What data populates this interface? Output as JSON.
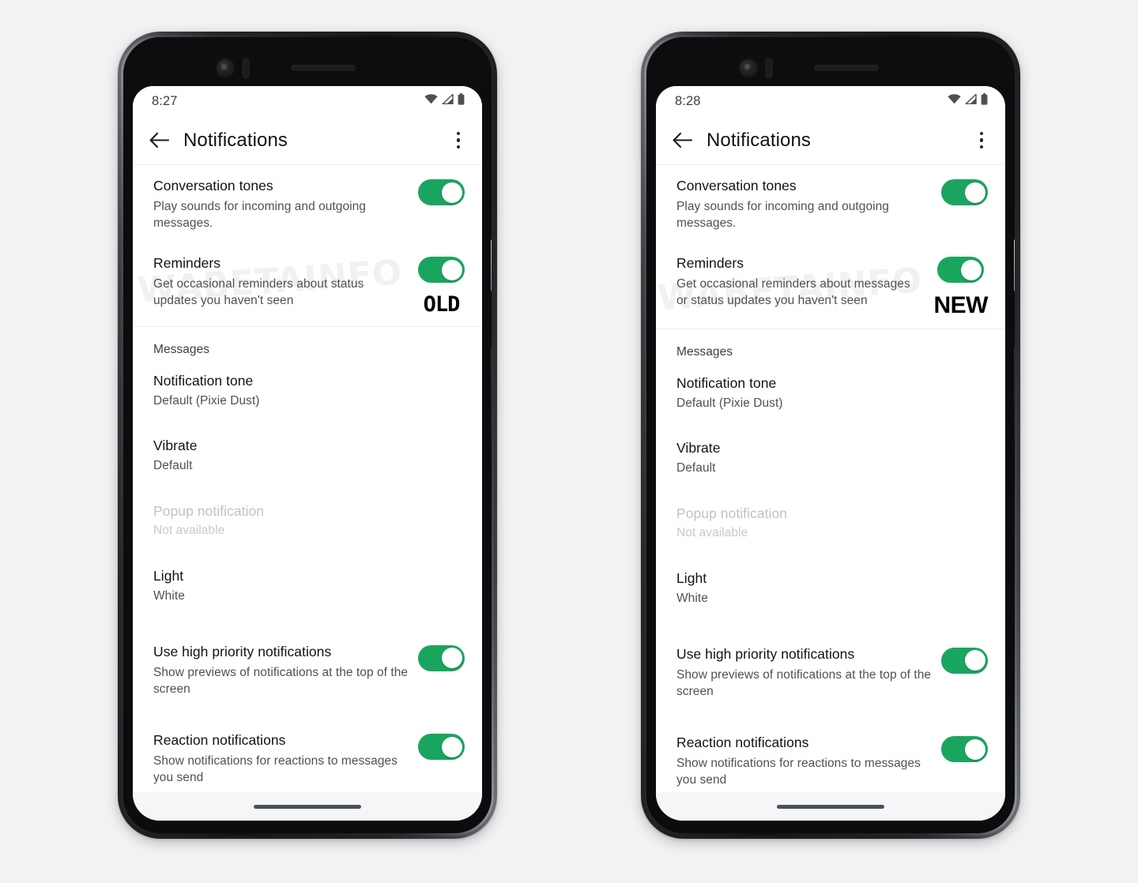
{
  "background_color": "#f1f2f4",
  "accent_green": "#1aa55f",
  "watermark": "WABETAINFO",
  "common": {
    "appbar_title": "Notifications",
    "back_icon": "arrow-left-icon",
    "overflow_icon": "more-vertical-icon",
    "status_icons": [
      "wifi-icon",
      "cellular-signal-icon",
      "battery-icon"
    ],
    "section_messages": "Messages",
    "rows": {
      "conversation_tones": {
        "title": "Conversation tones",
        "subtitle": "Play sounds for incoming and outgoing messages.",
        "toggle": "on"
      },
      "reminders": {
        "title": "Reminders",
        "toggle": "on"
      },
      "notification_tone": {
        "title": "Notification tone",
        "value": "Default (Pixie Dust)"
      },
      "vibrate": {
        "title": "Vibrate",
        "value": "Default"
      },
      "popup_notification": {
        "title": "Popup notification",
        "value": "Not available"
      },
      "light": {
        "title": "Light",
        "value": "White"
      },
      "high_priority": {
        "title": "Use high priority notifications",
        "subtitle": "Show previews of notifications at the top of the screen",
        "toggle": "on"
      },
      "reaction_notifications": {
        "title": "Reaction notifications",
        "subtitle": "Show notifications for reactions to messages you send",
        "toggle": "on"
      }
    }
  },
  "phone_left": {
    "badge": "OLD",
    "status_time": "8:27",
    "reminders_subtitle": "Get occasional reminders about status updates you haven't seen"
  },
  "phone_right": {
    "badge": "NEW",
    "status_time": "8:28",
    "reminders_subtitle": "Get occasional reminders about messages or status updates you haven't seen"
  }
}
